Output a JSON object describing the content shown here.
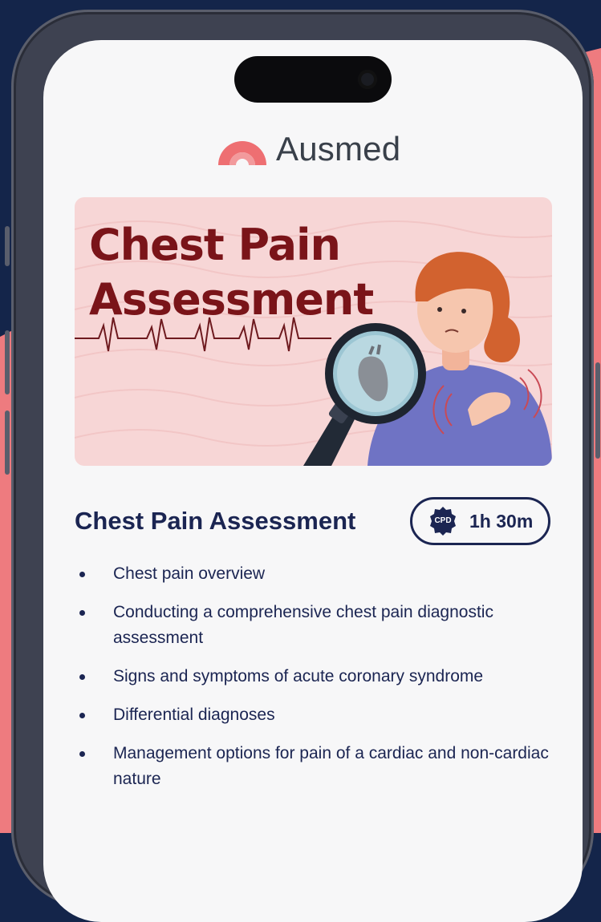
{
  "brand": {
    "name": "Ausmed",
    "logo_color": "#ee6f72",
    "text_color": "#39404a"
  },
  "hero": {
    "title_line1": "Chest Pain",
    "title_line2": "Assessment",
    "title_color": "#7a1419",
    "background": "#f7d6d6",
    "illustration": "woman-with-chest-pain-and-magnified-heart"
  },
  "course": {
    "title": "Chest Pain Assessment",
    "badge": {
      "icon": "cpd-seal-icon",
      "label": "CPD",
      "duration": "1h 30m"
    },
    "topics": [
      "Chest pain overview",
      "Conducting a comprehensive chest pain diagnostic assessment",
      "Signs and symptoms of acute coronary syndrome",
      "Differential diagnoses",
      "Management options for pain of a cardiac and non-cardiac nature"
    ]
  },
  "colors": {
    "page_background": "#14254a",
    "accent": "#ee6f72",
    "navy": "#1b2552"
  }
}
